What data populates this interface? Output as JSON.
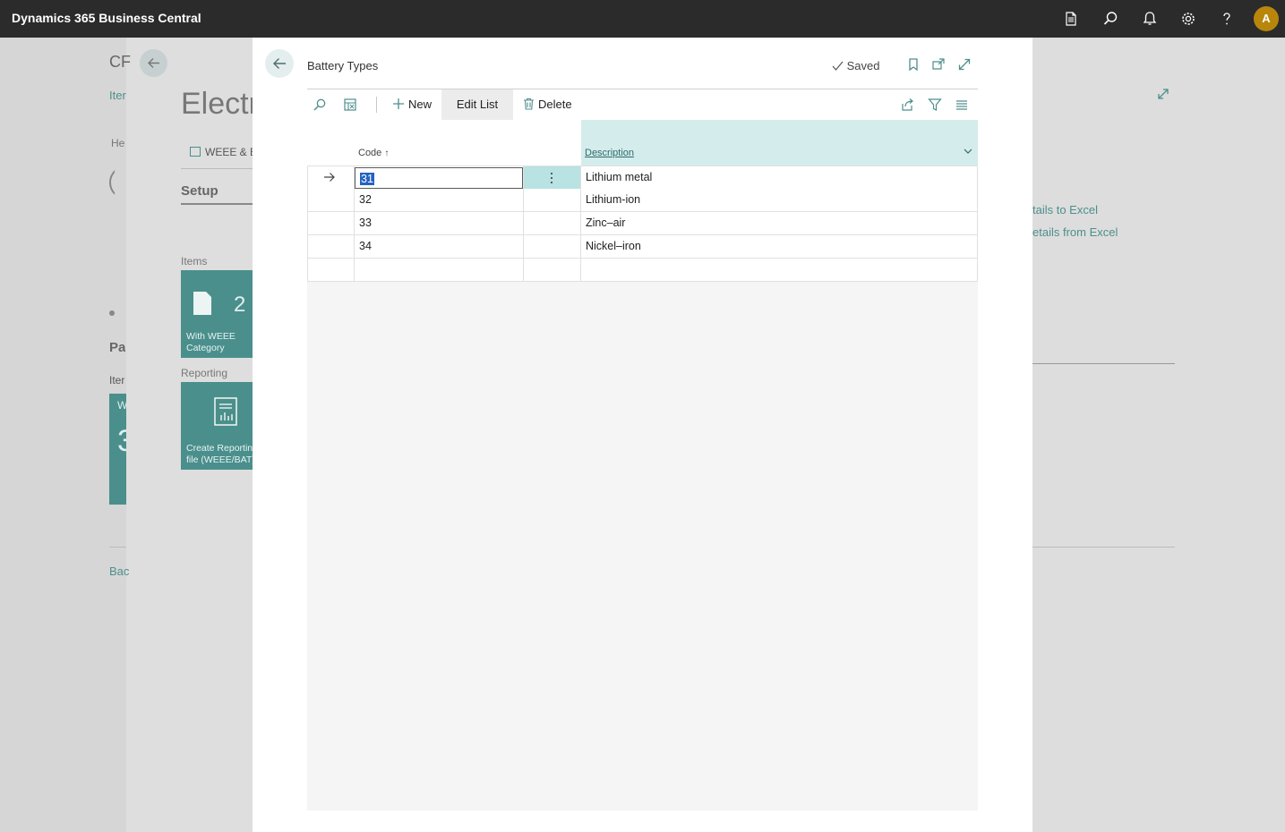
{
  "app": {
    "title": "Dynamics 365 Business Central",
    "user_initial": "A"
  },
  "background": {
    "page_code": "CF",
    "items_link": "Iter",
    "page_title": "Electr",
    "heading_label": "He",
    "weee_tab": "WEEE & E",
    "setup_label": "Setup",
    "items_label": "Items",
    "tile_items_count": "2",
    "tile_items_caption": "With WEEE Category",
    "reporting_label": "Reporting",
    "tile_report_caption": "Create Reporting file (WEEE/BAT)",
    "part_label": "Pa",
    "item_label": "Iter",
    "part_tile_prefix": "W",
    "part_tile_count": "3",
    "back_label": "Bac",
    "export_link": "tails to Excel",
    "import_link": "etails from Excel"
  },
  "dialog": {
    "title": "Battery Types",
    "status": "Saved",
    "actions": {
      "new": "New",
      "edit_list": "Edit List",
      "delete": "Delete"
    },
    "columns": {
      "code": "Code",
      "code_sort": "↑",
      "description": "Description"
    },
    "rows": [
      {
        "code": "31",
        "description": "Lithium metal"
      },
      {
        "code": "32",
        "description": "Lithium-ion"
      },
      {
        "code": "33",
        "description": "Zinc–air"
      },
      {
        "code": "34",
        "description": "Nickel–iron"
      }
    ]
  }
}
